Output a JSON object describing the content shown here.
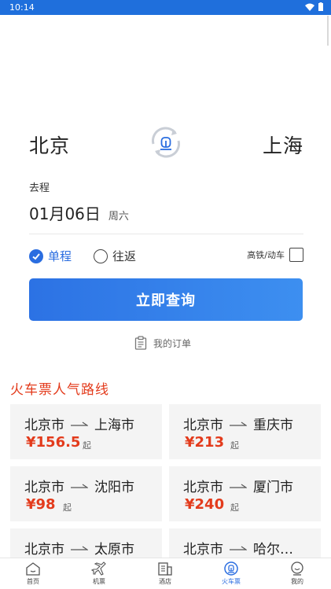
{
  "status_bar": {
    "time": "10:14"
  },
  "search": {
    "from_city": "北京",
    "to_city": "上海",
    "depart_label": "去程",
    "date": "01月06日",
    "weekday": "周六",
    "one_way_label": "单程",
    "round_trip_label": "往返",
    "high_speed_label": "高铁/动车",
    "search_button": "立即查询",
    "my_orders": "我的订单"
  },
  "popular": {
    "title": "火车票人气路线",
    "routes": [
      {
        "from": "北京市",
        "to": "上海市",
        "price": "¥156.5",
        "suffix": "起"
      },
      {
        "from": "北京市",
        "to": "重庆市",
        "price": "¥213",
        "suffix": "起"
      },
      {
        "from": "北京市",
        "to": "沈阳市",
        "price": "¥98",
        "suffix": "起"
      },
      {
        "from": "北京市",
        "to": "厦门市",
        "price": "¥240",
        "suffix": "起"
      },
      {
        "from": "北京市",
        "to": "太原市"
      },
      {
        "from": "北京市",
        "to": "哈尔…"
      }
    ]
  },
  "nav": {
    "items": [
      {
        "label": "首页",
        "icon": "home-icon"
      },
      {
        "label": "机票",
        "icon": "plane-icon"
      },
      {
        "label": "酒店",
        "icon": "hotel-icon"
      },
      {
        "label": "火车票",
        "icon": "train-icon",
        "active": true
      },
      {
        "label": "我的",
        "icon": "profile-icon"
      }
    ]
  },
  "colors": {
    "status_bar": "#1f6fdc",
    "accent": "#2a6de0",
    "price": "#e33b1c"
  }
}
